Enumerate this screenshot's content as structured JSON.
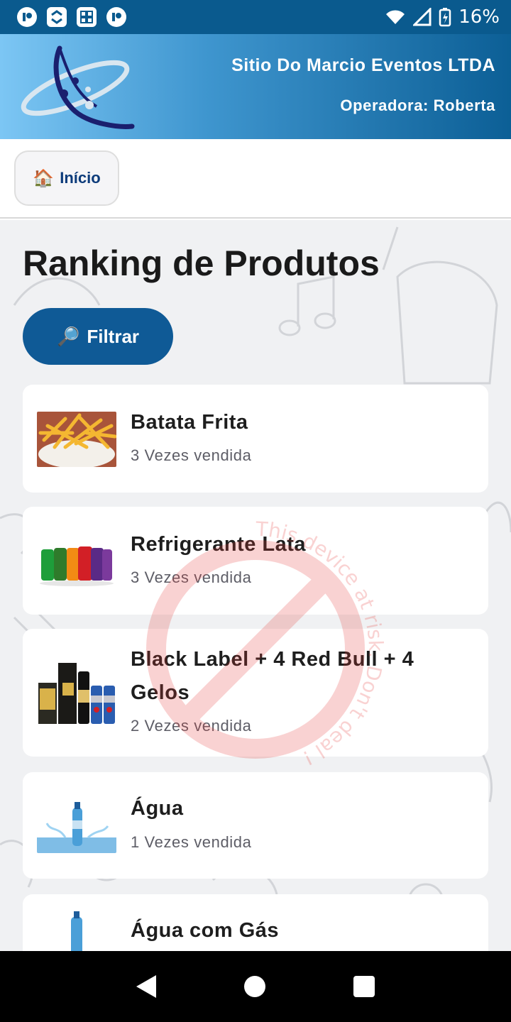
{
  "status_bar": {
    "battery": "16%",
    "icons": [
      "app-icon",
      "sync-icon",
      "grid-icon",
      "app-icon",
      "wifi-icon",
      "signal-icon",
      "battery-charging-icon"
    ]
  },
  "header": {
    "company": "Sitio Do Marcio Eventos LTDA",
    "operator": "Operadora: Roberta",
    "colors": {
      "gradient_start": "#7cc6f4",
      "gradient_end": "#0c5f96"
    }
  },
  "toolbar": {
    "home_icon": "house-icon",
    "home_label": "Início"
  },
  "main": {
    "title": "Ranking de Produtos",
    "filter_icon": "magnifier-icon",
    "filter_label": "Filtrar",
    "products": [
      {
        "name": "Batata Frita",
        "count": "3 Vezes vendida",
        "image": "fries-image"
      },
      {
        "name": "Refrigerante Lata",
        "count": "3 Vezes vendida",
        "image": "soda-cans-image"
      },
      {
        "name": "Black Label + 4 Red Bull + 4 Gelos",
        "count": "2 Vezes vendida",
        "image": "whisky-redbull-image"
      },
      {
        "name": "Água",
        "count": "1 Vezes vendida",
        "image": "water-bottle-image"
      },
      {
        "name": "Água com Gás",
        "count": "",
        "image": "sparkling-water-image"
      }
    ]
  },
  "watermark": {
    "text": "This device at risk. Don't deal !",
    "color": "#e53935"
  },
  "nav": {
    "back": "back-icon",
    "home": "home-icon",
    "recents": "recents-icon"
  }
}
